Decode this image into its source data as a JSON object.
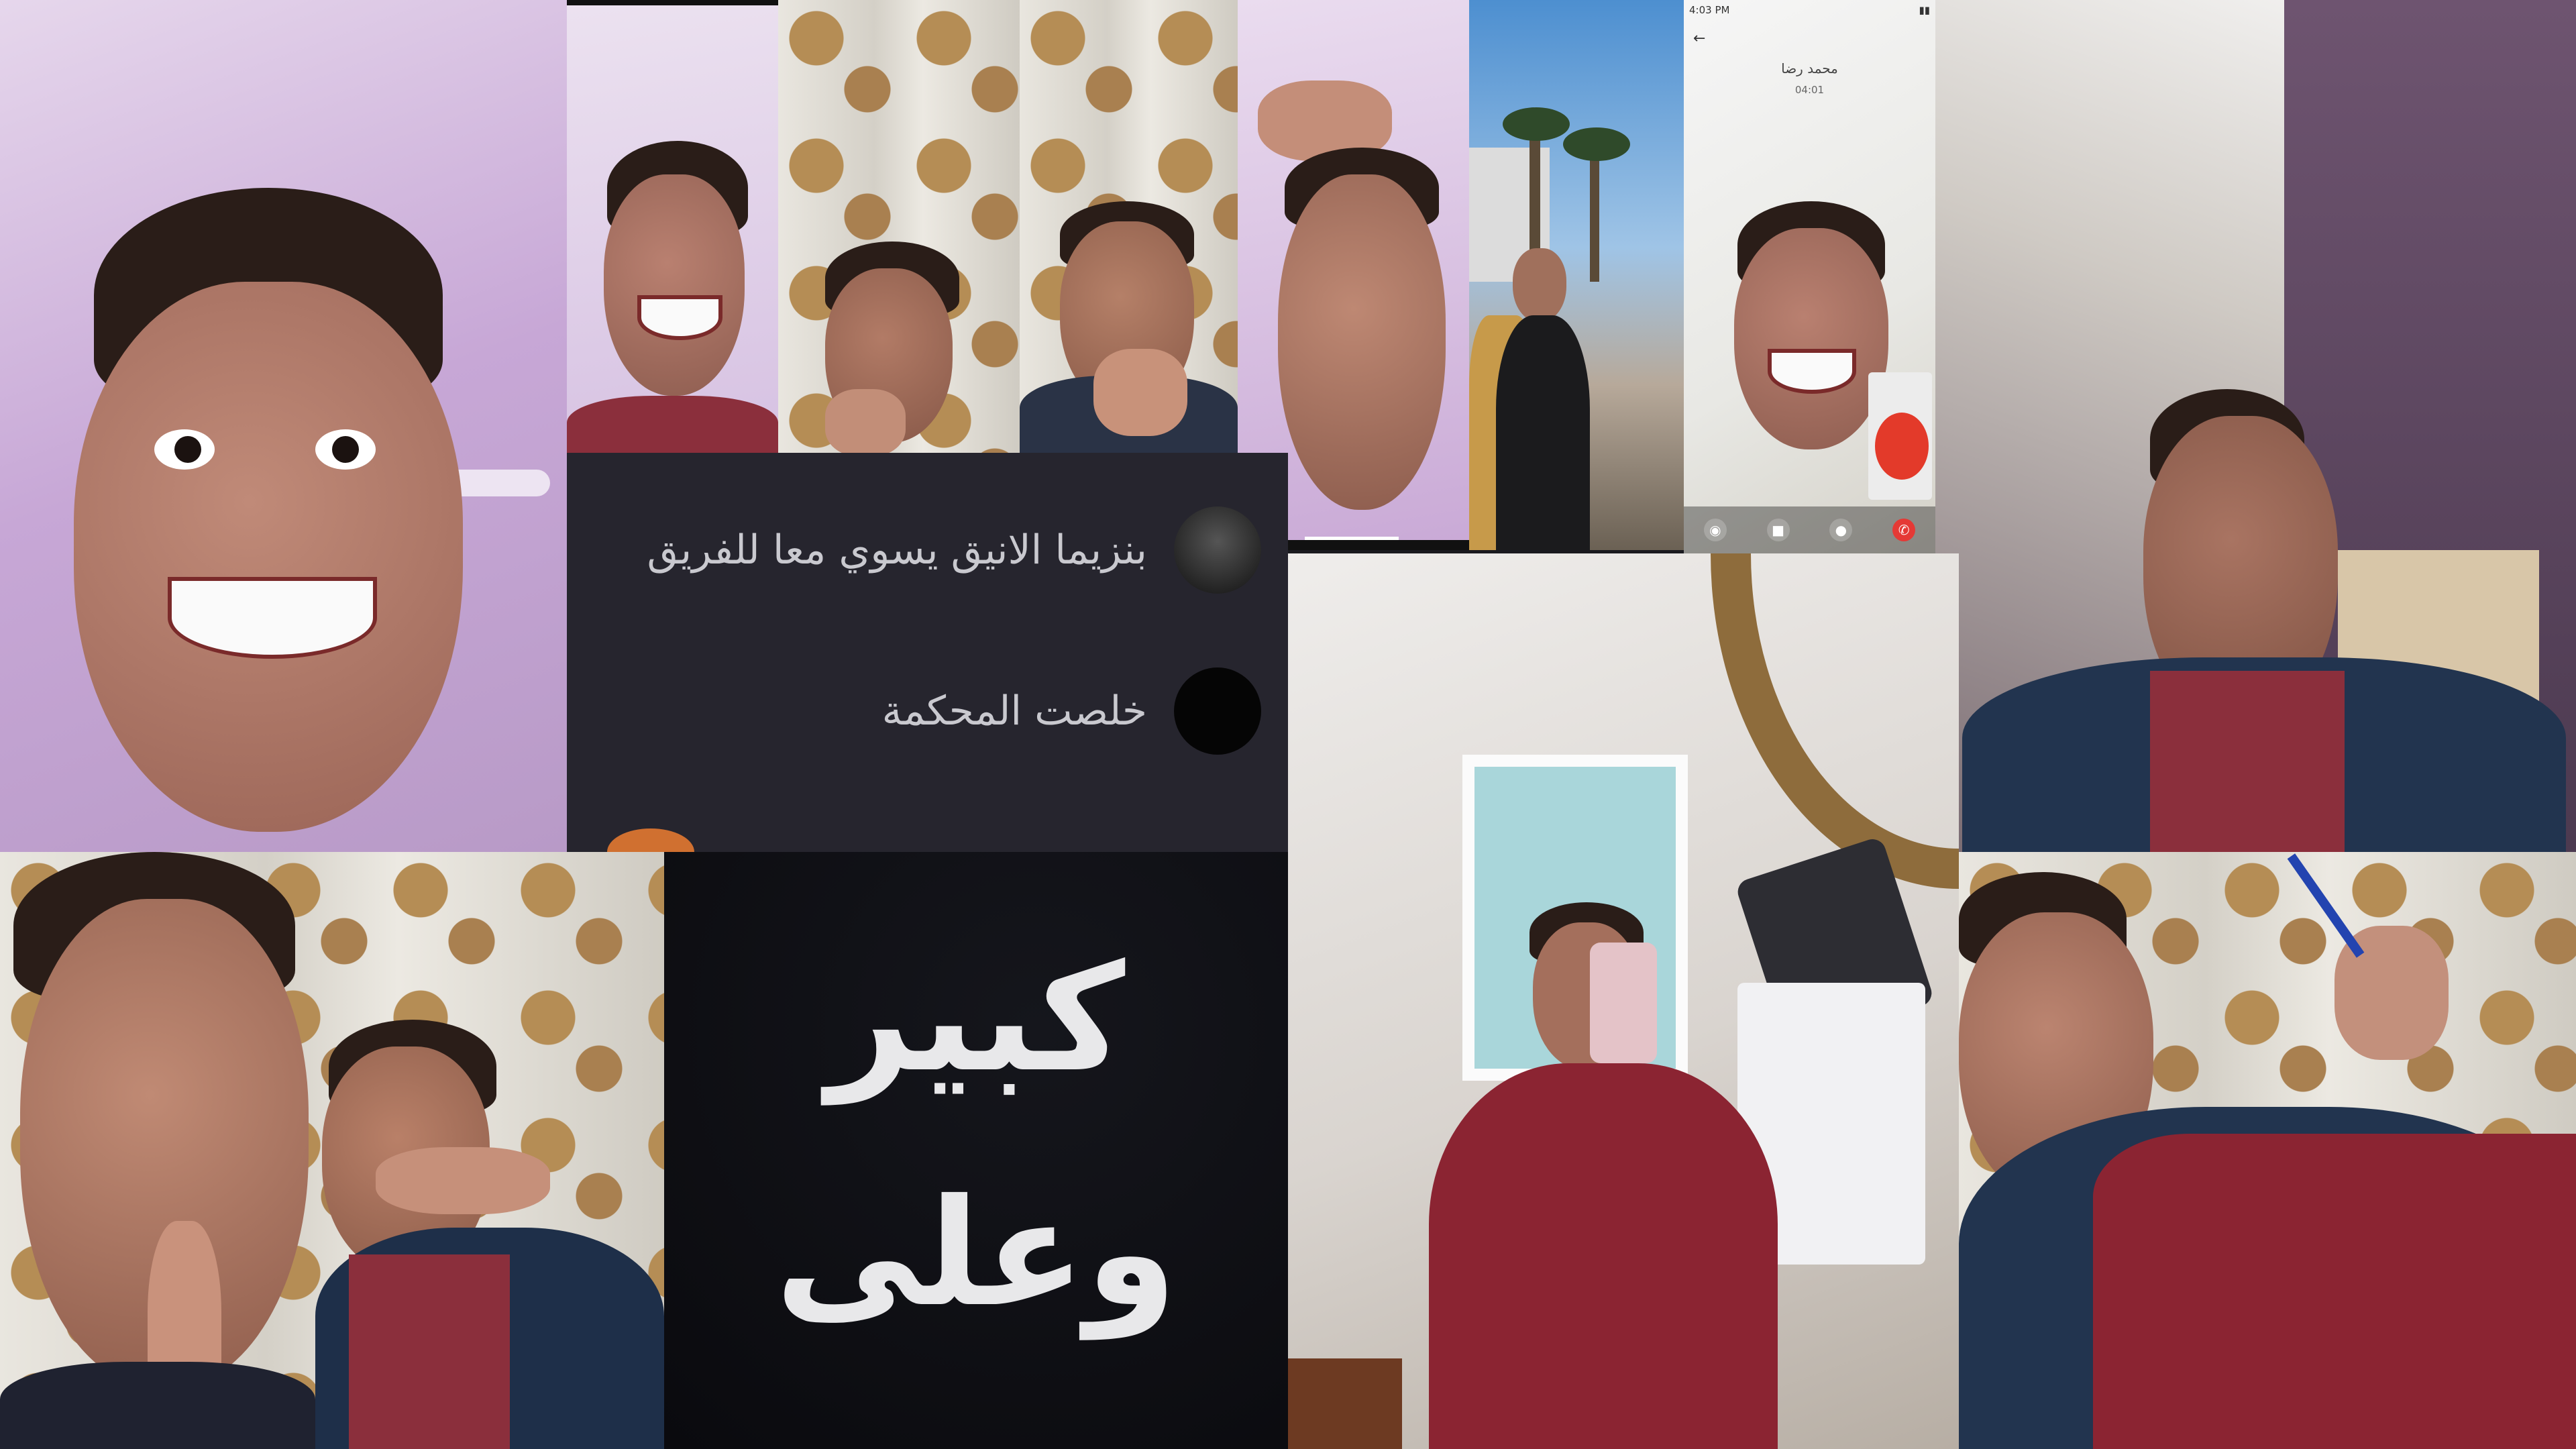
{
  "collage": {
    "chat": {
      "message_1": "بنزيما الانيق يسوي معا للفريق",
      "message_2": "خلصت المحكمة"
    },
    "caption": {
      "line_1": "كبير",
      "line_2": "وعلى"
    },
    "call_screen": {
      "contact_name": "محمد رضا",
      "duration": "04:01",
      "clock": "4:03 PM"
    }
  }
}
